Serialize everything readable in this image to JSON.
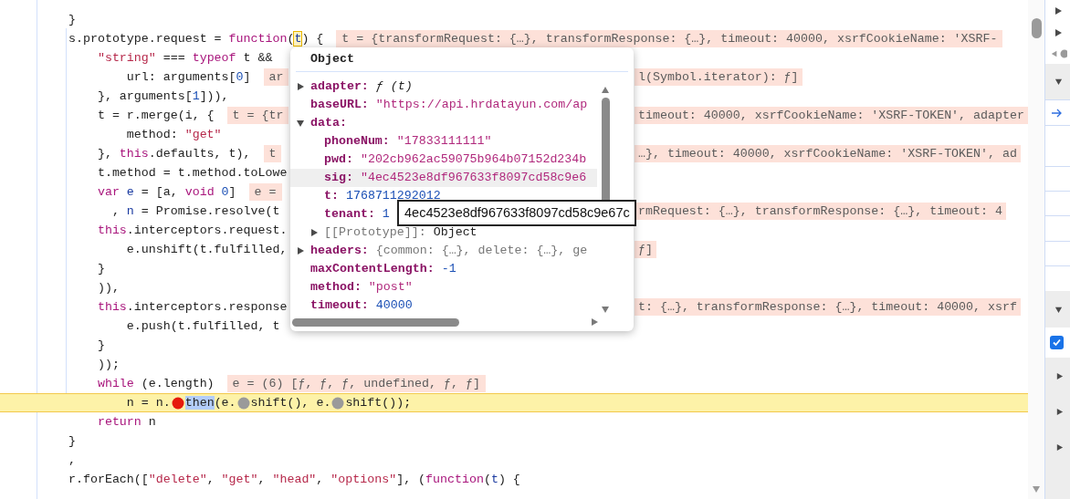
{
  "code_lines": [
    {
      "tokens": [
        {
          "kind": "plain",
          "text": "}"
        }
      ]
    },
    {
      "tokens": [
        {
          "kind": "plain",
          "text": "s.prototype.request = "
        },
        {
          "kind": "keyword",
          "text": "function"
        },
        {
          "kind": "plain",
          "text": "("
        },
        {
          "kind": "hovered",
          "text": "t"
        },
        {
          "kind": "plain",
          "text": ") {"
        }
      ],
      "value": "t = {transformRequest: {…}, transformResponse: {…}, timeout: 40000, xsrfCookieName: 'XSRF-"
    },
    {
      "tokens": [
        {
          "kind": "string",
          "text": "    \"string\""
        },
        {
          "kind": "plain",
          "text": " === "
        },
        {
          "kind": "keyword",
          "text": "typeof"
        },
        {
          "kind": "plain",
          "text": " t &&"
        }
      ]
    },
    {
      "tokens": [
        {
          "kind": "plain",
          "text": "        url: arguments["
        },
        {
          "kind": "number",
          "text": "0"
        },
        {
          "kind": "plain",
          "text": "]"
        }
      ],
      "value": "ar",
      "tail": "l(Symbol.iterator): ƒ]"
    },
    {
      "tokens": [
        {
          "kind": "plain",
          "text": "    }, arguments["
        },
        {
          "kind": "number",
          "text": "1"
        },
        {
          "kind": "plain",
          "text": "])),"
        }
      ]
    },
    {
      "tokens": [
        {
          "kind": "plain",
          "text": "    t = r.merge(i, {"
        }
      ],
      "value": "t = {tr",
      "tail": "timeout: 40000, xsrfCookieName: 'XSRF-TOKEN', adapter"
    },
    {
      "tokens": [
        {
          "kind": "plain",
          "text": "        method: "
        },
        {
          "kind": "string",
          "text": "\"get\""
        }
      ]
    },
    {
      "tokens": [
        {
          "kind": "plain",
          "text": "    }, "
        },
        {
          "kind": "keyword",
          "text": "this"
        },
        {
          "kind": "plain",
          "text": ".defaults, t),"
        }
      ],
      "value": "t",
      "tail": "…}, timeout: 40000, xsrfCookieName: 'XSRF-TOKEN', ad"
    },
    {
      "tokens": [
        {
          "kind": "plain",
          "text": "    t.method = t.method.toLowe"
        }
      ]
    },
    {
      "tokens": [
        {
          "kind": "keyword",
          "text": "    var "
        },
        {
          "kind": "definition",
          "text": "e"
        },
        {
          "kind": "plain",
          "text": " = [a, "
        },
        {
          "kind": "keyword",
          "text": "void "
        },
        {
          "kind": "number",
          "text": "0"
        },
        {
          "kind": "plain",
          "text": "]"
        }
      ],
      "value": "e ="
    },
    {
      "tokens": [
        {
          "kind": "plain",
          "text": "      , "
        },
        {
          "kind": "definition",
          "text": "n"
        },
        {
          "kind": "plain",
          "text": " = Promise.resolve(t"
        }
      ],
      "tail": "rmRequest: {…}, transformResponse: {…}, timeout: 4"
    },
    {
      "tokens": [
        {
          "kind": "keyword",
          "text": "    this"
        },
        {
          "kind": "plain",
          "text": ".interceptors.request."
        }
      ]
    },
    {
      "tokens": [
        {
          "kind": "plain",
          "text": "        e.unshift(t.fulfilled,"
        }
      ],
      "tail": "ƒ]"
    },
    {
      "tokens": [
        {
          "kind": "plain",
          "text": "    }"
        }
      ]
    },
    {
      "tokens": [
        {
          "kind": "plain",
          "text": "    )),"
        }
      ]
    },
    {
      "tokens": [
        {
          "kind": "keyword",
          "text": "    this"
        },
        {
          "kind": "plain",
          "text": ".interceptors.response"
        }
      ],
      "tail": "t: {…}, transformResponse: {…}, timeout: 40000, xsrf"
    },
    {
      "tokens": [
        {
          "kind": "plain",
          "text": "        e.push(t.fulfilled, t"
        }
      ]
    },
    {
      "tokens": [
        {
          "kind": "plain",
          "text": "    }"
        }
      ]
    },
    {
      "tokens": [
        {
          "kind": "plain",
          "text": "    ));"
        }
      ]
    },
    {
      "tokens": [
        {
          "kind": "keyword",
          "text": "    while"
        },
        {
          "kind": "plain",
          "text": " (e.length)"
        }
      ],
      "value": "e = (6) [ƒ, ƒ, ƒ, undefined, ƒ, ƒ]"
    },
    {
      "current": true,
      "tokens": [
        {
          "kind": "plain",
          "text": "        n = n."
        },
        {
          "kind": "breakpoint",
          "active": true
        },
        {
          "kind": "selection",
          "text": "then"
        },
        {
          "kind": "plain",
          "text": "(e."
        },
        {
          "kind": "breakpoint",
          "active": false
        },
        {
          "kind": "plain",
          "text": "shift(), e."
        },
        {
          "kind": "breakpoint",
          "active": false
        },
        {
          "kind": "plain",
          "text": "shift());"
        }
      ]
    },
    {
      "tokens": [
        {
          "kind": "keyword",
          "text": "    return"
        },
        {
          "kind": "plain",
          "text": " n"
        }
      ]
    },
    {
      "tokens": [
        {
          "kind": "plain",
          "text": "}"
        }
      ]
    },
    {
      "tokens": [
        {
          "kind": "plain",
          "text": ","
        }
      ]
    },
    {
      "tokens": [
        {
          "kind": "plain",
          "text": "r.forEach(["
        },
        {
          "kind": "string",
          "text": "\"delete\""
        },
        {
          "kind": "plain",
          "text": ", "
        },
        {
          "kind": "string",
          "text": "\"get\""
        },
        {
          "kind": "plain",
          "text": ", "
        },
        {
          "kind": "string",
          "text": "\"head\""
        },
        {
          "kind": "plain",
          "text": ", "
        },
        {
          "kind": "string",
          "text": "\"options\""
        },
        {
          "kind": "plain",
          "text": "], ("
        },
        {
          "kind": "keyword",
          "text": "function"
        },
        {
          "kind": "plain",
          "text": "("
        },
        {
          "kind": "definition",
          "text": "t"
        },
        {
          "kind": "plain",
          "text": ") {"
        }
      ]
    }
  ],
  "popover": {
    "title": "Object",
    "properties": [
      {
        "key": "adapter:",
        "value": "ƒ (t)",
        "kind": "function",
        "expanded": false,
        "hovered": false
      },
      {
        "key": "baseURL:",
        "value": "\"https://api.hrdatayun.com/ap",
        "kind": "string",
        "hovered": false
      },
      {
        "key": "data:",
        "expanded": true,
        "hovered": false,
        "children": [
          {
            "key": "phoneNum:",
            "value": "\"17833111111\"",
            "kind": "string",
            "hovered": false
          },
          {
            "key": "pwd:",
            "value": "\"202cb962ac59075b964b07152d234b",
            "kind": "string",
            "hovered": false
          },
          {
            "key": "sig:",
            "value": "\"4ec4523e8df967633f8097cd58c9e6",
            "kind": "string",
            "hovered": true
          },
          {
            "key": "t:",
            "value": "1768711292012",
            "kind": "number",
            "hovered": false
          },
          {
            "key": "tenant:",
            "value": "1",
            "kind": "number",
            "hovered": false
          },
          {
            "key": "[[Prototype]]:",
            "value": "Object",
            "kind": "internal",
            "expanded": false,
            "hovered": false
          }
        ]
      },
      {
        "key": "headers:",
        "value": "{common: {…}, delete: {…}, ge",
        "kind": "preview",
        "expanded": false,
        "hovered": false
      },
      {
        "key": "maxContentLength:",
        "value": "-1",
        "kind": "number",
        "hovered": false
      },
      {
        "key": "method:",
        "value": "\"post\"",
        "kind": "string",
        "hovered": false
      },
      {
        "key": "timeout:",
        "value": "40000",
        "kind": "number",
        "hovered": false
      }
    ]
  },
  "tooltip": {
    "text": "4ec4523e8df967633f8097cd58c9e67c"
  },
  "sidebar": {
    "checkbox_checked": true
  }
}
